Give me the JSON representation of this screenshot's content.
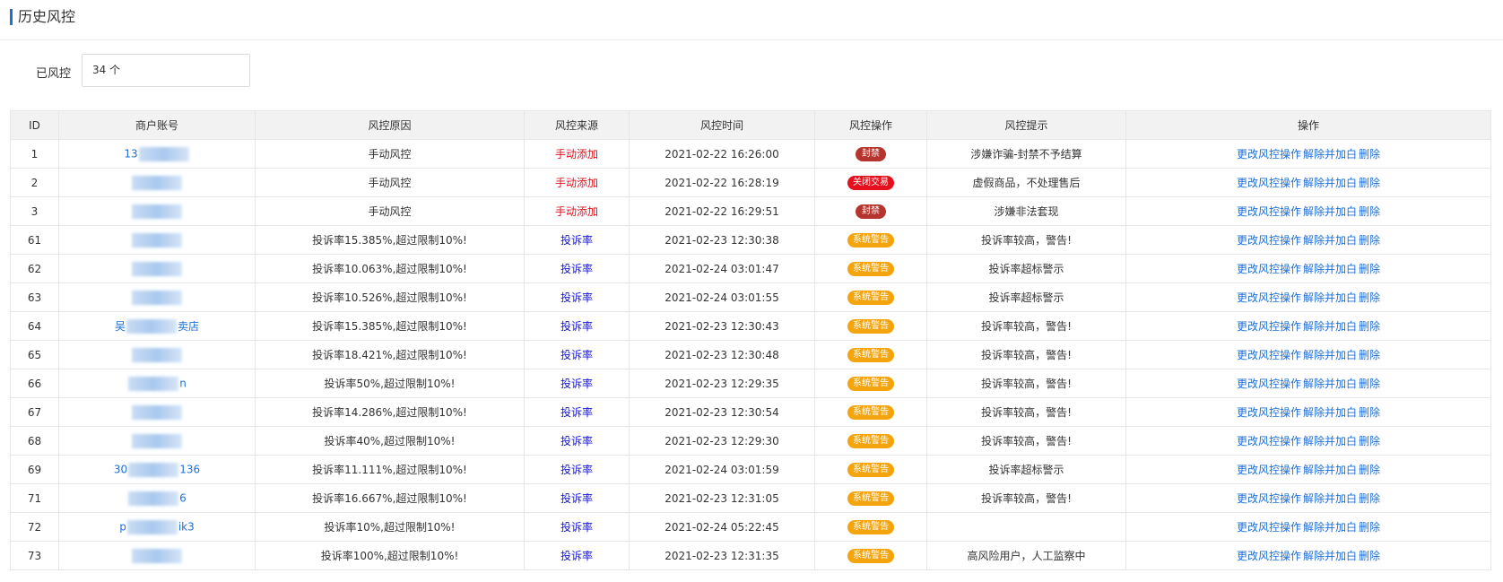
{
  "header": {
    "title": "历史风控"
  },
  "stats": {
    "label": "已风控",
    "value": "34 个"
  },
  "table": {
    "columns": [
      "ID",
      "商户账号",
      "风控原因",
      "风控来源",
      "风控时间",
      "风控操作",
      "风控提示",
      "操作"
    ],
    "actions": {
      "change": "更改风控操作",
      "release": "解除并加白",
      "delete": "删除"
    },
    "rows": [
      {
        "id": "1",
        "account_pre": "13",
        "account_post": "",
        "reason": "手动风控",
        "source": "手动添加",
        "time": "2021-02-22 16:26:00",
        "op": "封禁",
        "tip": "涉嫌诈骗-封禁不予结算"
      },
      {
        "id": "2",
        "account_pre": "",
        "account_post": "",
        "reason": "手动风控",
        "source": "手动添加",
        "time": "2021-02-22 16:28:19",
        "op": "关闭交易",
        "tip": "虚假商品，不处理售后"
      },
      {
        "id": "3",
        "account_pre": "",
        "account_post": "",
        "reason": "手动风控",
        "source": "手动添加",
        "time": "2021-02-22 16:29:51",
        "op": "封禁",
        "tip": "涉嫌非法套现"
      },
      {
        "id": "61",
        "account_pre": "",
        "account_post": "",
        "reason": "投诉率15.385%,超过限制10%!",
        "source": "投诉率",
        "time": "2021-02-23 12:30:38",
        "op": "系统警告",
        "tip": "投诉率较高，警告!"
      },
      {
        "id": "62",
        "account_pre": "",
        "account_post": "",
        "reason": "投诉率10.063%,超过限制10%!",
        "source": "投诉率",
        "time": "2021-02-24 03:01:47",
        "op": "系统警告",
        "tip": "投诉率超标警示"
      },
      {
        "id": "63",
        "account_pre": "",
        "account_post": "",
        "reason": "投诉率10.526%,超过限制10%!",
        "source": "投诉率",
        "time": "2021-02-24 03:01:55",
        "op": "系统警告",
        "tip": "投诉率超标警示"
      },
      {
        "id": "64",
        "account_pre": "吴",
        "account_post": "卖店",
        "reason": "投诉率15.385%,超过限制10%!",
        "source": "投诉率",
        "time": "2021-02-23 12:30:43",
        "op": "系统警告",
        "tip": "投诉率较高，警告!"
      },
      {
        "id": "65",
        "account_pre": "",
        "account_post": "",
        "reason": "投诉率18.421%,超过限制10%!",
        "source": "投诉率",
        "time": "2021-02-23 12:30:48",
        "op": "系统警告",
        "tip": "投诉率较高，警告!"
      },
      {
        "id": "66",
        "account_pre": "",
        "account_post": "n",
        "reason": "投诉率50%,超过限制10%!",
        "source": "投诉率",
        "time": "2021-02-23 12:29:35",
        "op": "系统警告",
        "tip": "投诉率较高，警告!"
      },
      {
        "id": "67",
        "account_pre": "",
        "account_post": "",
        "reason": "投诉率14.286%,超过限制10%!",
        "source": "投诉率",
        "time": "2021-02-23 12:30:54",
        "op": "系统警告",
        "tip": "投诉率较高，警告!"
      },
      {
        "id": "68",
        "account_pre": "",
        "account_post": "",
        "reason": "投诉率40%,超过限制10%!",
        "source": "投诉率",
        "time": "2021-02-23 12:29:30",
        "op": "系统警告",
        "tip": "投诉率较高，警告!"
      },
      {
        "id": "69",
        "account_pre": "30",
        "account_post": "136",
        "reason": "投诉率11.111%,超过限制10%!",
        "source": "投诉率",
        "time": "2021-02-24 03:01:59",
        "op": "系统警告",
        "tip": "投诉率超标警示"
      },
      {
        "id": "71",
        "account_pre": "",
        "account_post": "6",
        "reason": "投诉率16.667%,超过限制10%!",
        "source": "投诉率",
        "time": "2021-02-23 12:31:05",
        "op": "系统警告",
        "tip": "投诉率较高，警告!"
      },
      {
        "id": "72",
        "account_pre": "p",
        "account_post": "ik3",
        "reason": "投诉率10%,超过限制10%!",
        "source": "投诉率",
        "time": "2021-02-24 05:22:45",
        "op": "系统警告",
        "tip": ""
      },
      {
        "id": "73",
        "account_pre": "",
        "account_post": "",
        "reason": "投诉率100%,超过限制10%!",
        "source": "投诉率",
        "time": "2021-02-23 12:31:35",
        "op": "系统警告",
        "tip": "高风险用户，人工监察中"
      }
    ]
  },
  "colors": {
    "accent": "#1e6fd9",
    "danger": "#e5101d",
    "ban": "#b5342e",
    "warn": "#f5a40e",
    "rate": "#1515d6"
  }
}
